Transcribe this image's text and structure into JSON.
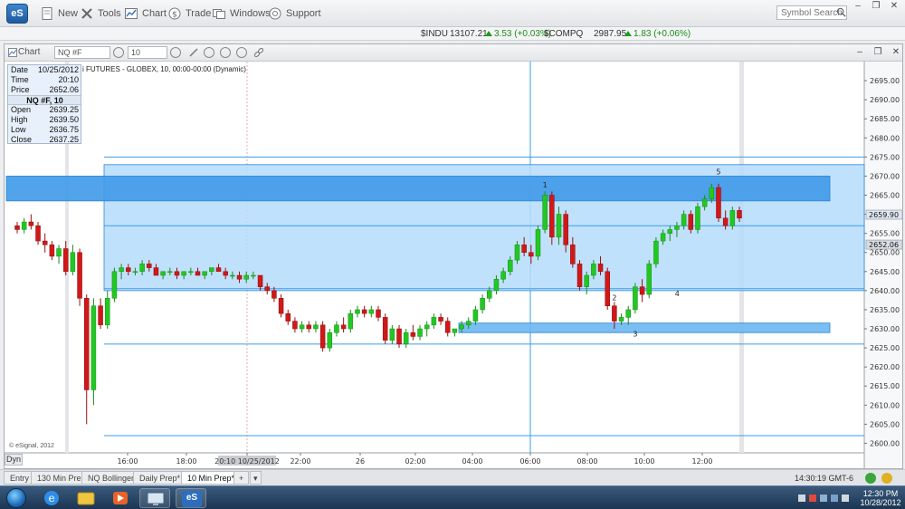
{
  "app": {
    "logo": "eS",
    "menu": [
      {
        "label": "New",
        "icon": "new-page-icon"
      },
      {
        "label": "Tools",
        "icon": "tools-icon"
      },
      {
        "label": "Chart",
        "icon": "chart-icon"
      },
      {
        "label": "Trade",
        "icon": "trade-icon"
      },
      {
        "label": "Windows",
        "icon": "windows-icon"
      },
      {
        "label": "Support",
        "icon": "support-icon"
      }
    ],
    "search_placeholder": "Symbol Search"
  },
  "ticker": {
    "indu_symbol": "$INDU",
    "indu_price": "13107.21",
    "indu_change": "3.53 (+0.03%)",
    "compq_symbol": "$COMPQ",
    "compq_price": "2987.95",
    "compq_change": "1.83 (+0.06%)"
  },
  "chart_window": {
    "title": "Chart",
    "symbol_input": "NQ #F",
    "interval_input": "10",
    "status_line": "i FUTURES - GLOBEX, 10, 00:00-00:00 (Dynamic)",
    "watermark": "© eSignal, 2012",
    "dyn_label": "Dyn"
  },
  "data_window": {
    "date_label": "Date",
    "date_value": "10/25/2012",
    "time_label": "Time",
    "time_value": "20:10",
    "price_label": "Price",
    "price_value": "2652.06",
    "symbol": "NQ #F, 10",
    "open_label": "Open",
    "open_value": "2639.25",
    "high_label": "High",
    "high_value": "2639.50",
    "low_label": "Low",
    "low_value": "2636.75",
    "close_label": "Close",
    "close_value": "2637.25"
  },
  "chart_data": {
    "type": "candlestick",
    "title": "",
    "xlabel": "",
    "ylabel": "",
    "ylim": [
      2597.5,
      2700
    ],
    "y_ticks": [
      2600,
      2605,
      2610,
      2615,
      2620,
      2625,
      2630,
      2635,
      2640,
      2645,
      2650,
      2655,
      2660,
      2665,
      2670,
      2675,
      2680,
      2685,
      2690,
      2695
    ],
    "x_ticks": [
      "16:00",
      "18:00",
      "20:10 10/25/2012",
      "22:00",
      "26",
      "02:00",
      "04:00",
      "06:00",
      "08:00",
      "10:00",
      "12:00"
    ],
    "price_tags": [
      {
        "value": 2659.9,
        "color": "#dfe8f2"
      },
      {
        "value": 2652.06,
        "color": "#d8dde3"
      }
    ],
    "horizontal_lines": [
      2675,
      2657,
      2640.5,
      2626,
      2602
    ],
    "zones": [
      {
        "y_top": 2673,
        "y_bottom": 2640,
        "color": "#b5dcfb"
      },
      {
        "y_top": 2670,
        "y_bottom": 2663.5,
        "color": "#3f9ae8"
      },
      {
        "y_top": 2631.5,
        "y_bottom": 2629,
        "color": "#6cb7f2"
      }
    ],
    "wave_labels": [
      {
        "text": "1",
        "price": 2667
      },
      {
        "text": "2",
        "price": 2637.5
      },
      {
        "text": "3",
        "price": 2628
      },
      {
        "text": "4",
        "price": 2638.5
      },
      {
        "text": "5",
        "price": 2670.5
      }
    ],
    "candles": [
      [
        2657,
        2658,
        2655,
        2656
      ],
      [
        2656,
        2659,
        2655,
        2658
      ],
      [
        2658,
        2660,
        2656,
        2657
      ],
      [
        2657,
        2658,
        2652,
        2653
      ],
      [
        2653,
        2655,
        2650,
        2652
      ],
      [
        2652,
        2653,
        2648,
        2649
      ],
      [
        2649,
        2652,
        2647,
        2651
      ],
      [
        2651,
        2653,
        2644,
        2645
      ],
      [
        2645,
        2652,
        2644,
        2650
      ],
      [
        2650,
        2651,
        2636,
        2638
      ],
      [
        2638,
        2639,
        2605,
        2614
      ],
      [
        2614,
        2638,
        2610,
        2636
      ],
      [
        2636,
        2638,
        2630,
        2631
      ],
      [
        2631,
        2640,
        2630,
        2638
      ],
      [
        2638,
        2646,
        2637,
        2645
      ],
      [
        2645,
        2647,
        2643,
        2646
      ],
      [
        2646,
        2647,
        2644,
        2645
      ],
      [
        2645,
        2646,
        2644,
        2645
      ],
      [
        2645,
        2648,
        2644,
        2647
      ],
      [
        2647,
        2648,
        2645,
        2646
      ],
      [
        2646,
        2647,
        2644,
        2644
      ],
      [
        2644,
        2645,
        2643,
        2645
      ],
      [
        2645,
        2646,
        2644,
        2645
      ],
      [
        2645,
        2646,
        2643,
        2644
      ],
      [
        2644,
        2645,
        2643,
        2645
      ],
      [
        2645,
        2646,
        2644,
        2645
      ],
      [
        2645,
        2646,
        2644,
        2644
      ],
      [
        2644,
        2645,
        2643,
        2645
      ],
      [
        2645,
        2646,
        2644,
        2646
      ],
      [
        2646,
        2647,
        2645,
        2645
      ],
      [
        2645,
        2646,
        2643,
        2644
      ],
      [
        2644,
        2645,
        2643,
        2644
      ],
      [
        2644,
        2645,
        2642,
        2643
      ],
      [
        2643,
        2645,
        2642,
        2644
      ],
      [
        2644,
        2645,
        2643,
        2644
      ],
      [
        2644,
        2644,
        2640,
        2641
      ],
      [
        2641,
        2642,
        2639,
        2640
      ],
      [
        2640,
        2641,
        2637,
        2638
      ],
      [
        2638,
        2639,
        2633,
        2634
      ],
      [
        2634,
        2635,
        2631,
        2632
      ],
      [
        2632,
        2633,
        2629,
        2630
      ],
      [
        2630,
        2632,
        2629,
        2631
      ],
      [
        2631,
        2632,
        2629,
        2630
      ],
      [
        2630,
        2632,
        2629,
        2631
      ],
      [
        2631,
        2632,
        2624,
        2625
      ],
      [
        2625,
        2630,
        2624,
        2629
      ],
      [
        2629,
        2632,
        2628,
        2631
      ],
      [
        2631,
        2633,
        2629,
        2630
      ],
      [
        2630,
        2635,
        2629,
        2634
      ],
      [
        2634,
        2636,
        2633,
        2635
      ],
      [
        2635,
        2636,
        2633,
        2634
      ],
      [
        2634,
        2636,
        2633,
        2635
      ],
      [
        2635,
        2636,
        2632,
        2633
      ],
      [
        2633,
        2634,
        2626,
        2627
      ],
      [
        2627,
        2631,
        2626,
        2630
      ],
      [
        2630,
        2631,
        2625,
        2626
      ],
      [
        2626,
        2630,
        2625,
        2629
      ],
      [
        2629,
        2631,
        2627,
        2628
      ],
      [
        2628,
        2631,
        2627,
        2630
      ],
      [
        2630,
        2632,
        2628,
        2631
      ],
      [
        2631,
        2634,
        2630,
        2633
      ],
      [
        2633,
        2634,
        2631,
        2632
      ],
      [
        2632,
        2633,
        2628,
        2629
      ],
      [
        2629,
        2630,
        2628,
        2630
      ],
      [
        2630,
        2632,
        2629,
        2631
      ],
      [
        2631,
        2633,
        2630,
        2632
      ],
      [
        2632,
        2636,
        2631,
        2635
      ],
      [
        2635,
        2639,
        2634,
        2638
      ],
      [
        2638,
        2641,
        2637,
        2640
      ],
      [
        2640,
        2644,
        2639,
        2643
      ],
      [
        2643,
        2646,
        2642,
        2645
      ],
      [
        2645,
        2649,
        2644,
        2648
      ],
      [
        2648,
        2653,
        2647,
        2652
      ],
      [
        2652,
        2654,
        2649,
        2650
      ],
      [
        2650,
        2652,
        2647,
        2649
      ],
      [
        2649,
        2657,
        2648,
        2656
      ],
      [
        2656,
        2666,
        2655,
        2665
      ],
      [
        2665,
        2666,
        2652,
        2654
      ],
      [
        2654,
        2662,
        2652,
        2660
      ],
      [
        2660,
        2661,
        2650,
        2652
      ],
      [
        2652,
        2654,
        2646,
        2647
      ],
      [
        2647,
        2648,
        2640,
        2641
      ],
      [
        2641,
        2645,
        2639,
        2644
      ],
      [
        2644,
        2648,
        2643,
        2647
      ],
      [
        2647,
        2649,
        2644,
        2645
      ],
      [
        2645,
        2646,
        2635,
        2636
      ],
      [
        2636,
        2637,
        2630,
        2632
      ],
      [
        2632,
        2634,
        2631,
        2633
      ],
      [
        2633,
        2636,
        2631,
        2635
      ],
      [
        2635,
        2642,
        2634,
        2641
      ],
      [
        2641,
        2643,
        2637,
        2639
      ],
      [
        2639,
        2648,
        2638,
        2647
      ],
      [
        2647,
        2654,
        2646,
        2653
      ],
      [
        2653,
        2656,
        2652,
        2655
      ],
      [
        2655,
        2657,
        2653,
        2656
      ],
      [
        2656,
        2658,
        2654,
        2657
      ],
      [
        2657,
        2661,
        2656,
        2660
      ],
      [
        2660,
        2661,
        2655,
        2656
      ],
      [
        2656,
        2663,
        2655,
        2662
      ],
      [
        2662,
        2665,
        2661,
        2664
      ],
      [
        2664,
        2668,
        2663,
        2667
      ],
      [
        2667,
        2668,
        2658,
        2659
      ],
      [
        2659,
        2661,
        2656,
        2657
      ],
      [
        2657,
        2662,
        2656,
        2661
      ],
      [
        2661,
        2662,
        2658,
        2659
      ]
    ]
  },
  "tabs": [
    "Entry",
    "130 Min Prep",
    "NQ Bollinger",
    "Daily Prep*",
    "10 Min Prep*"
  ],
  "active_tab": "10 Min Prep*",
  "tab_add": "+",
  "clock_status": "14:30:19 GMT-6",
  "taskbar": {
    "time": "12:30 PM",
    "date": "10/28/2012",
    "open_app": "eS"
  }
}
